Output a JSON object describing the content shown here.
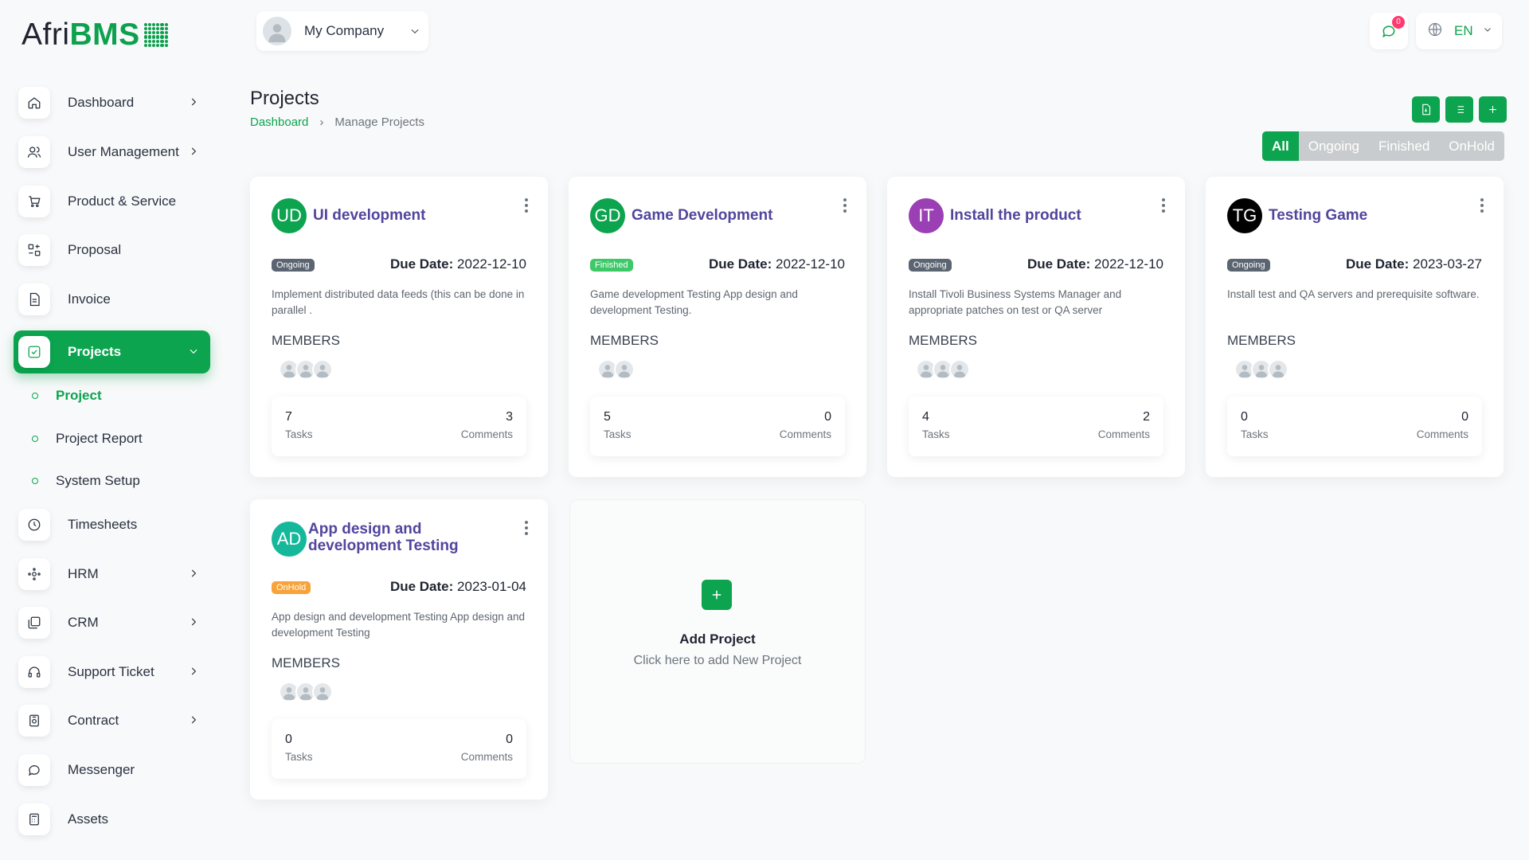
{
  "brand": {
    "part1": "Afri",
    "part2": "BMS"
  },
  "company": {
    "name": "My Company"
  },
  "header": {
    "notification_count": "0",
    "language": "EN"
  },
  "sidebar": {
    "items": [
      {
        "label": "Dashboard",
        "icon": "home-icon",
        "chevron": true
      },
      {
        "label": "User Management",
        "icon": "users-icon",
        "chevron": true
      },
      {
        "label": "Product & Service",
        "icon": "cart-icon",
        "chevron": false
      },
      {
        "label": "Proposal",
        "icon": "proposal-icon",
        "chevron": false
      },
      {
        "label": "Invoice",
        "icon": "file-icon",
        "chevron": false
      },
      {
        "label": "Projects",
        "icon": "check-square-icon",
        "chevron": true,
        "active": true
      },
      {
        "label": "Timesheets",
        "icon": "clock-icon",
        "chevron": false
      },
      {
        "label": "HRM",
        "icon": "hrm-icon",
        "chevron": true
      },
      {
        "label": "CRM",
        "icon": "crm-icon",
        "chevron": true
      },
      {
        "label": "Support Ticket",
        "icon": "headset-icon",
        "chevron": true
      },
      {
        "label": "Contract",
        "icon": "contract-icon",
        "chevron": true
      },
      {
        "label": "Messenger",
        "icon": "message-icon",
        "chevron": false
      },
      {
        "label": "Assets",
        "icon": "calculator-icon",
        "chevron": false
      }
    ],
    "sub_items": [
      {
        "label": "Project",
        "active": true
      },
      {
        "label": "Project Report",
        "active": false
      },
      {
        "label": "System Setup",
        "active": false
      }
    ]
  },
  "page": {
    "title": "Projects",
    "breadcrumb": {
      "home": "Dashboard",
      "separator": "›",
      "current": "Manage Projects"
    }
  },
  "filters": [
    "All",
    "Ongoing",
    "Finished",
    "OnHold"
  ],
  "projects": [
    {
      "initials": "UD",
      "avatar_color": "#0ca44f",
      "title": "UI development",
      "status": "Ongoing",
      "status_color": "#5b6571",
      "due_label": "Due Date:",
      "due_date": "2022-12-10",
      "description": "Implement distributed data feeds (this can be done in parallel .",
      "members_label": "MEMBERS",
      "member_count": 3,
      "tasks": "7",
      "tasks_label": "Tasks",
      "comments": "3",
      "comments_label": "Comments"
    },
    {
      "initials": "GD",
      "avatar_color": "#0ca44f",
      "title": "Game Development",
      "status": "Finished",
      "status_color": "#3ec968",
      "due_label": "Due Date:",
      "due_date": "2022-12-10",
      "description": "Game development Testing App design and development Testing.",
      "members_label": "MEMBERS",
      "member_count": 2,
      "tasks": "5",
      "tasks_label": "Tasks",
      "comments": "0",
      "comments_label": "Comments"
    },
    {
      "initials": "IT",
      "avatar_color": "#9b3fb5",
      "title": "Install the product",
      "status": "Ongoing",
      "status_color": "#5b6571",
      "due_label": "Due Date:",
      "due_date": "2022-12-10",
      "description": "Install Tivoli Business Systems Manager and appropriate patches on test or QA server",
      "members_label": "MEMBERS",
      "member_count": 3,
      "tasks": "4",
      "tasks_label": "Tasks",
      "comments": "2",
      "comments_label": "Comments"
    },
    {
      "initials": "TG",
      "avatar_color": "#000000",
      "title": "Testing Game",
      "status": "Ongoing",
      "status_color": "#5b6571",
      "due_label": "Due Date:",
      "due_date": "2023-03-27",
      "description": "Install test and QA servers and prerequisite software.",
      "members_label": "MEMBERS",
      "member_count": 3,
      "tasks": "0",
      "tasks_label": "Tasks",
      "comments": "0",
      "comments_label": "Comments"
    },
    {
      "initials": "AD",
      "avatar_color": "#15b89a",
      "title": "App design and development Testing",
      "status": "OnHold",
      "status_color": "#f7a33a",
      "due_label": "Due Date:",
      "due_date": "2023-01-04",
      "description": "App design and development Testing App design and development Testing",
      "members_label": "MEMBERS",
      "member_count": 3,
      "tasks": "0",
      "tasks_label": "Tasks",
      "comments": "0",
      "comments_label": "Comments"
    }
  ],
  "add_project": {
    "title": "Add Project",
    "subtitle": "Click here to add New Project"
  },
  "colors": {
    "primary": "#0ca44f",
    "title": "#51459d"
  }
}
